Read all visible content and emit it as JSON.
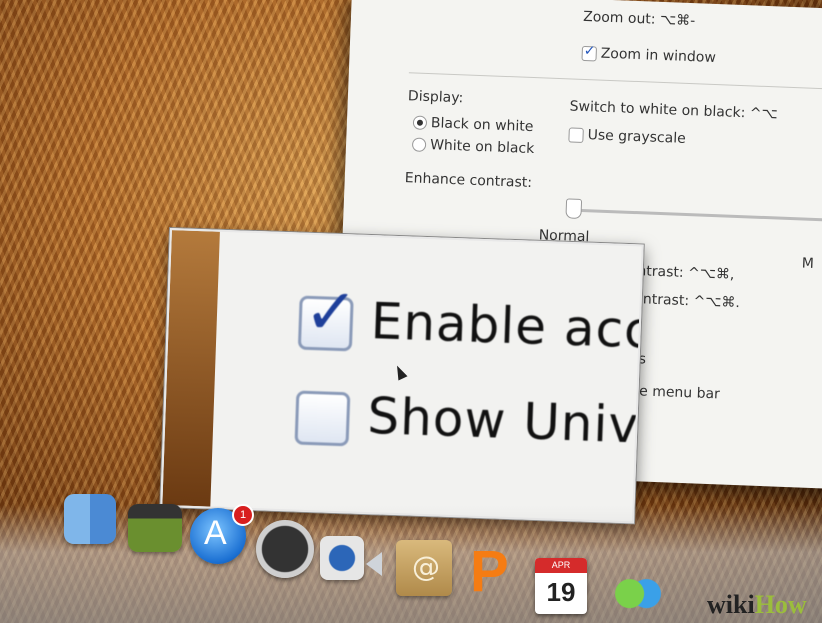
{
  "preferences": {
    "zoom_out_label": "Zoom out: ⌥⌘-",
    "zoom_in_window_label": "Zoom in window",
    "zoom_in_window_checked": true,
    "display_label": "Display:",
    "black_on_white": "Black on white",
    "white_on_black": "White on black",
    "switch_label": "Switch to white on black: ^⌥",
    "use_grayscale": "Use grayscale",
    "enhance_contrast_label": "Enhance contrast:",
    "normal_label": "Normal",
    "max_label": "M",
    "contrast_up": "ntrast: ^⌥⌘,",
    "contrast_down": "ontrast: ^⌥⌘.",
    "partial_es": "es",
    "menu_bar": "the menu bar"
  },
  "zoom_overlay": {
    "enable_access_label": "Enable acc",
    "enable_access_checked": true,
    "show_universal_label": "Show Univ",
    "show_universal_checked": false
  },
  "dock": {
    "app_store_badge": "1",
    "calendar_month": "APR",
    "calendar_day": "19",
    "items": [
      "finder-icon",
      "photo-booth-icon",
      "app-store-icon",
      "dashboard-icon",
      "iphoto-icon",
      "address-book-icon",
      "pages-icon",
      "calendar-icon",
      "messenger-icon"
    ]
  },
  "watermark": {
    "part1": "wiki",
    "part2": "How"
  },
  "colors": {
    "checkbox_blue": "#1e3f9a",
    "badge_red": "#d81e1e",
    "wikihow_green": "#9bbd3c"
  }
}
